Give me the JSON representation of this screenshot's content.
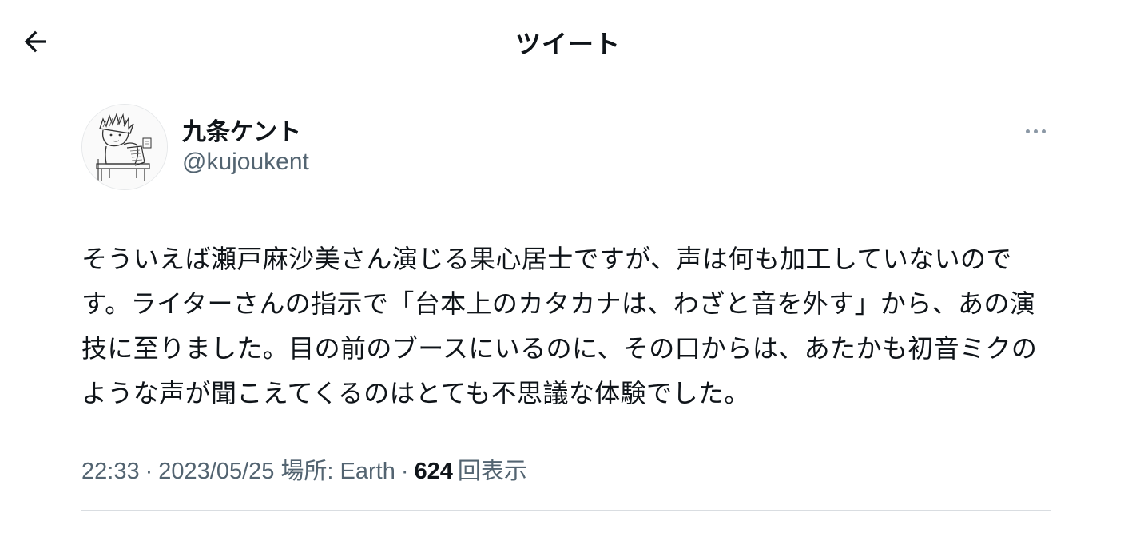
{
  "header": {
    "title": "ツイート",
    "back_icon": "arrow-left-icon"
  },
  "author": {
    "display_name": "九条ケント",
    "handle": "@kujoukent",
    "avatar_icon": "sketch-avatar"
  },
  "more_icon": "more-dots-icon",
  "tweet": {
    "text": "そういえば瀬戸麻沙美さん演じる果心居士ですが、声は何も加工していないのです。ライターさんの指示で「台本上のカタカナは、わざと音を外す」から、あの演技に至りました。目の前のブースにいるのに、その口からは、あたかも初音ミクのような声が聞こえてくるのはとても不思議な体験でした。"
  },
  "meta": {
    "time": "22:33",
    "separator": "·",
    "date": "2023/05/25",
    "location_label": "場所: Earth",
    "views_count": "624",
    "views_label": "回表示"
  },
  "colors": {
    "text_primary": "#0f1419",
    "text_secondary": "#536471",
    "divider": "#d9dde1"
  }
}
